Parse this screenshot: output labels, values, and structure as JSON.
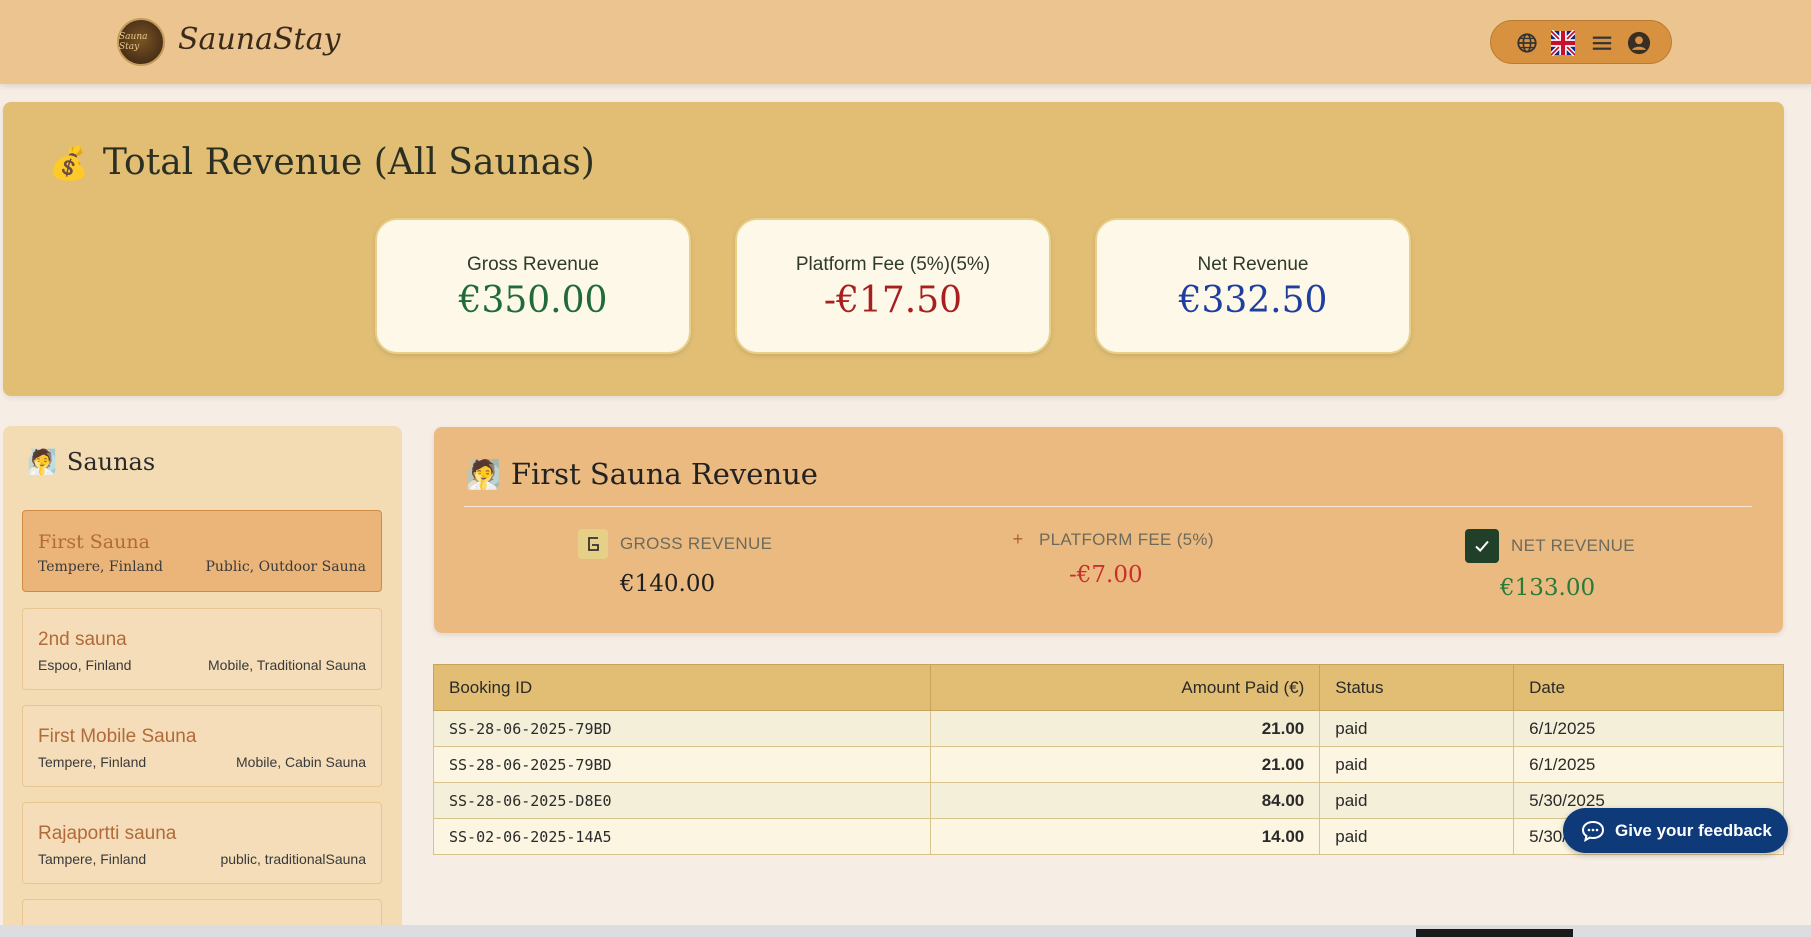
{
  "header": {
    "logo_text": "Sauna Stay",
    "brand": "SaunaStay",
    "nav_icons": [
      "globe-icon",
      "uk-flag-icon",
      "hamburger-menu-icon",
      "user-account-icon"
    ]
  },
  "total": {
    "icon": "💰",
    "title": "Total Revenue (All Saunas)",
    "cards": [
      {
        "label": "Gross Revenue",
        "value": "€350.00",
        "color": "#1f6b3a"
      },
      {
        "label": "Platform Fee (5%)(5%)",
        "value": "-€17.50",
        "color": "#a81f1f"
      },
      {
        "label": "Net Revenue",
        "value": "€332.50",
        "color": "#1f3fa0"
      }
    ]
  },
  "sidebar": {
    "icon": "🧖",
    "title": "Saunas",
    "items": [
      {
        "name": "First Sauna",
        "location": "Tempere, Finland",
        "type": "Public, Outdoor Sauna",
        "active": true
      },
      {
        "name": "2nd sauna",
        "location": "Espoo, Finland",
        "type": "Mobile, Traditional Sauna",
        "active": false
      },
      {
        "name": "First Mobile Sauna",
        "location": "Tempere, Finland",
        "type": "Mobile, Cabin Sauna",
        "active": false
      },
      {
        "name": "Rajaportti sauna",
        "location": "Tampere, Finland",
        "type": "public, traditionalSauna",
        "active": false
      }
    ]
  },
  "detail": {
    "icon": "🧖",
    "title": "First Sauna Revenue",
    "stats": [
      {
        "label": "GROSS REVENUE",
        "value": "€140.00",
        "icon": "gross-icon",
        "color": "#1e1e1e"
      },
      {
        "label": "PLATFORM FEE (5%)",
        "value": "-€7.00",
        "icon": "plus-icon",
        "color": "#c9302c"
      },
      {
        "label": "NET REVENUE",
        "value": "€133.00",
        "icon": "check-icon",
        "color": "#2a7a3a"
      }
    ]
  },
  "table": {
    "columns": [
      "Booking ID",
      "Amount Paid (€)",
      "Status",
      "Date"
    ],
    "rows": [
      [
        "SS-28-06-2025-79BD",
        "21.00",
        "paid",
        "6/1/2025"
      ],
      [
        "SS-28-06-2025-79BD",
        "21.00",
        "paid",
        "6/1/2025"
      ],
      [
        "SS-28-06-2025-D8E0",
        "84.00",
        "paid",
        "5/30/2025"
      ],
      [
        "SS-02-06-2025-14A5",
        "14.00",
        "paid",
        "5/30/2025"
      ]
    ]
  },
  "feedback": {
    "label": "Give your feedback",
    "icon": "chat-icon"
  }
}
